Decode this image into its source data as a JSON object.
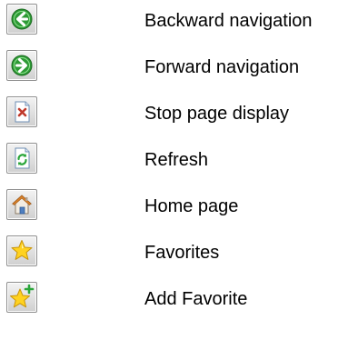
{
  "legend": {
    "items": [
      {
        "icon": "back-arrow-icon",
        "label": "Backward navigation"
      },
      {
        "icon": "forward-arrow-icon",
        "label": "Forward navigation"
      },
      {
        "icon": "stop-page-icon",
        "label": "Stop page display"
      },
      {
        "icon": "refresh-icon",
        "label": "Refresh"
      },
      {
        "icon": "home-icon",
        "label": "Home page"
      },
      {
        "icon": "favorites-star-icon",
        "label": "Favorites"
      },
      {
        "icon": "add-favorite-star-icon",
        "label": "Add Favorite"
      }
    ]
  },
  "colors": {
    "nav_green": "#2d9a35",
    "stop_red": "#c0392b",
    "star_yellow": "#ffd21f",
    "plus_green": "#2aa63a"
  }
}
